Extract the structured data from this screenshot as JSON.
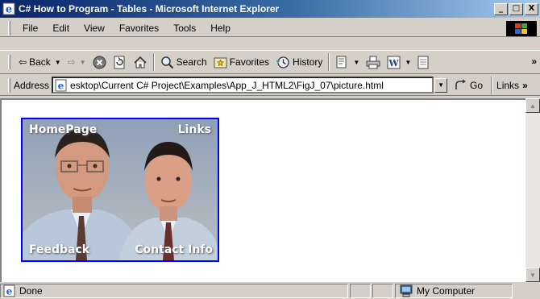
{
  "window": {
    "title": "C# How to Program - Tables - Microsoft Internet Explorer",
    "controls": [
      "_",
      "□",
      "X"
    ]
  },
  "menu": [
    "File",
    "Edit",
    "View",
    "Favorites",
    "Tools",
    "Help"
  ],
  "toolbar": {
    "back": "Back",
    "search": "Search",
    "favorites": "Favorites",
    "history": "History",
    "more": "»"
  },
  "address": {
    "label": "Address",
    "url": "esktop\\Current C# Project\\Examples\\App_J_HTML2\\FigJ_07\\picture.html",
    "go": "Go",
    "links": "Links",
    "more": "»"
  },
  "page": {
    "image_map": {
      "top_left": "HomePage",
      "top_right": "Links",
      "bottom_left": "Feedback",
      "bottom_right": "Contact Info"
    }
  },
  "status": {
    "text": "Done",
    "zone": "My Computer"
  },
  "colors": {
    "title_gradient_start": "#0a246a",
    "title_gradient_end": "#a6caf0",
    "link_border": "#0000ff",
    "chrome": "#d4d0c8"
  }
}
